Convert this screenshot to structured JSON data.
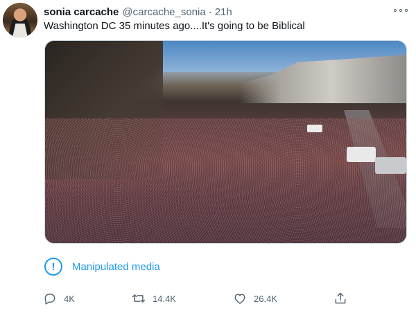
{
  "author": {
    "name": "sonia carcache",
    "handle": "@carcache_sonia",
    "separator": "·",
    "time": "21h"
  },
  "tweet": {
    "text": "Washington DC 35 minutes ago....It's going to be Biblical"
  },
  "icons": {
    "more": "more-options-icon",
    "reply": "reply-icon",
    "retweet": "retweet-icon",
    "like": "heart-icon",
    "share": "share-icon",
    "manipulated": "exclamation-circle-icon"
  },
  "notice": {
    "icon_glyph": "!",
    "label": "Manipulated media"
  },
  "stats": {
    "replies": "4K",
    "retweets": "14.4K",
    "likes": "26.4K"
  },
  "colors": {
    "accent": "#1d9bf0",
    "secondary_text": "#536471",
    "primary_text": "#0f1419"
  }
}
